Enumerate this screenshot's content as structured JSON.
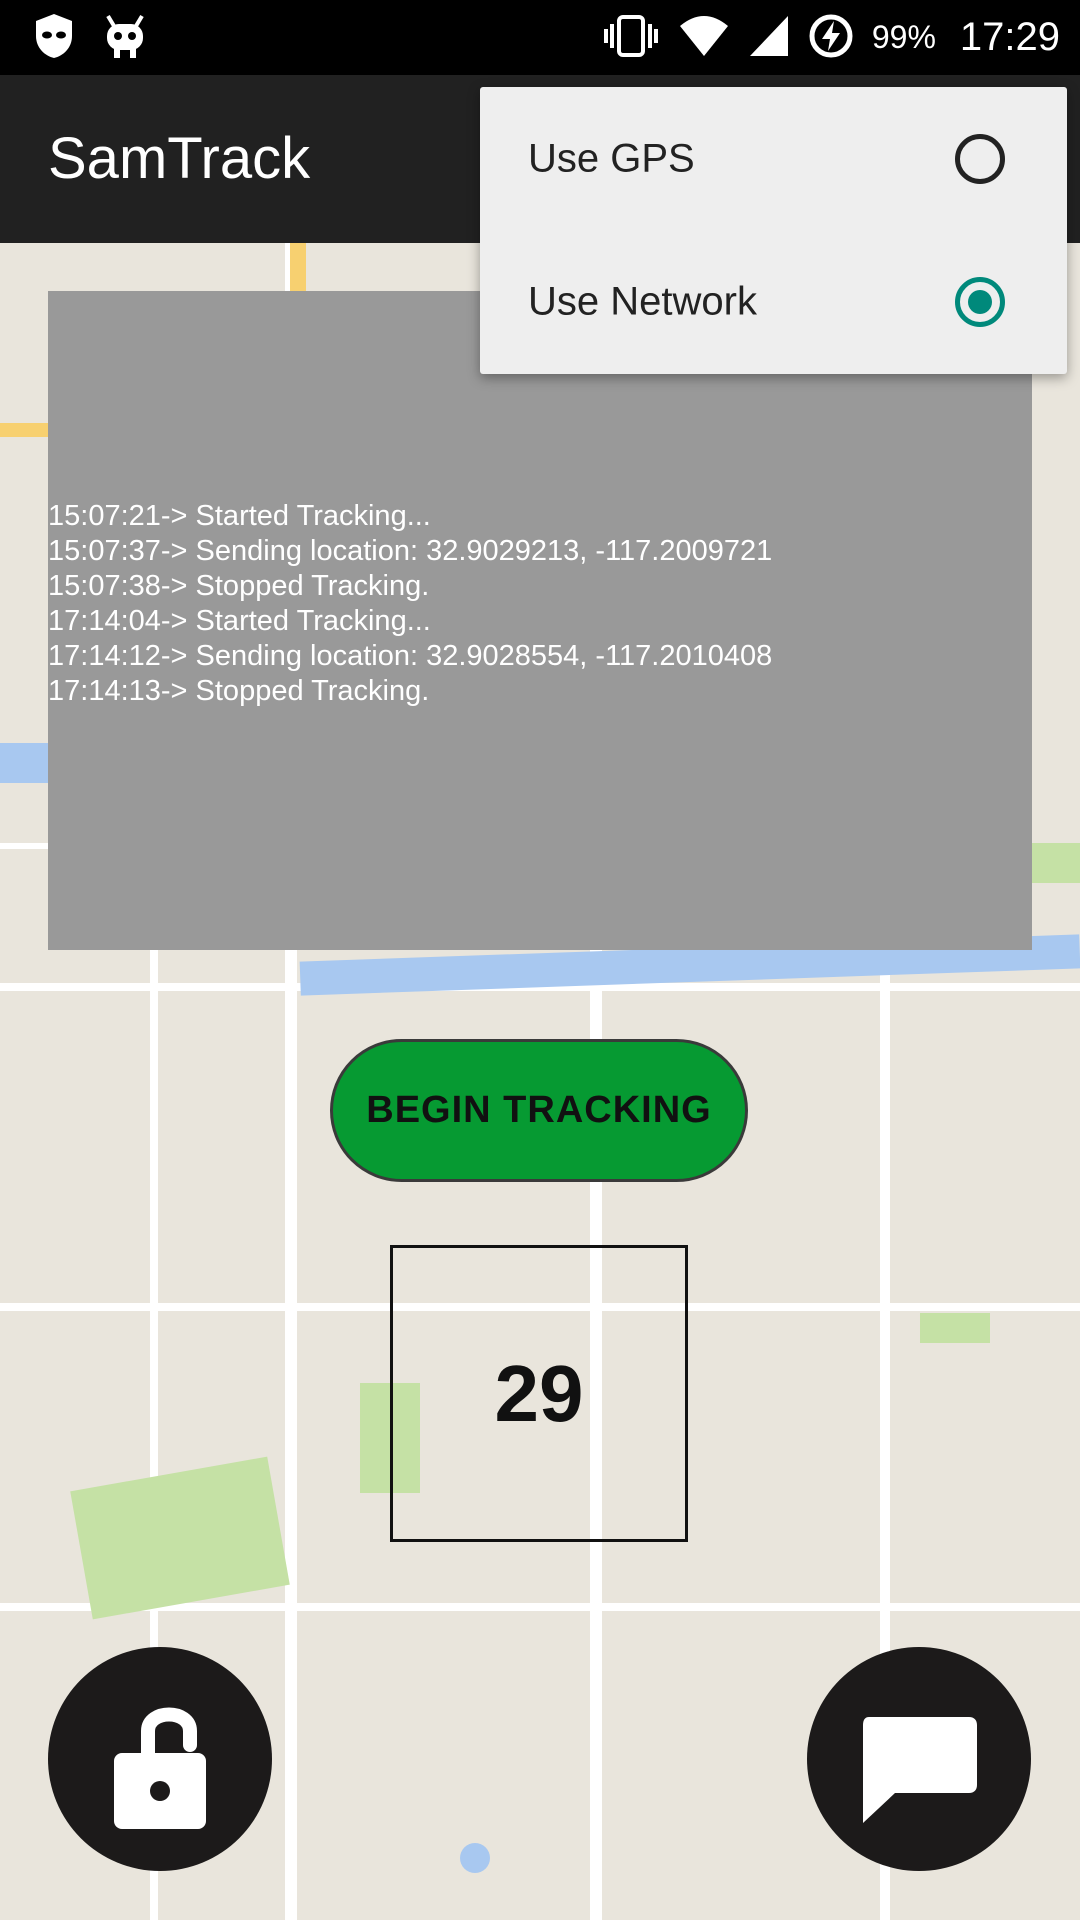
{
  "status_bar": {
    "battery": "99%",
    "time": "17:29",
    "icons": [
      "shield-icon",
      "android-icon",
      "vibrate-icon",
      "wifi-icon",
      "signal-icon",
      "battery-charging-icon"
    ]
  },
  "app_bar": {
    "title": "SamTrack"
  },
  "menu": {
    "items": [
      {
        "label": "Use GPS",
        "checked": false
      },
      {
        "label": "Use Network",
        "checked": true
      }
    ],
    "accent_color": "#00897b"
  },
  "log": {
    "lines": [
      "15:07:21-> Started Tracking...",
      "15:07:37-> Sending location: 32.9029213, -117.2009721",
      "15:07:38-> Stopped Tracking.",
      "17:14:04-> Started Tracking...",
      "17:14:12-> Sending location: 32.9028554, -117.2010408",
      "17:14:13-> Stopped Tracking."
    ]
  },
  "tracking_button": {
    "label": "BEGIN TRACKING",
    "color": "#069a32"
  },
  "counter": {
    "value": "29"
  },
  "fabs": {
    "left_icon": "lock-open-icon",
    "right_icon": "message-icon"
  }
}
